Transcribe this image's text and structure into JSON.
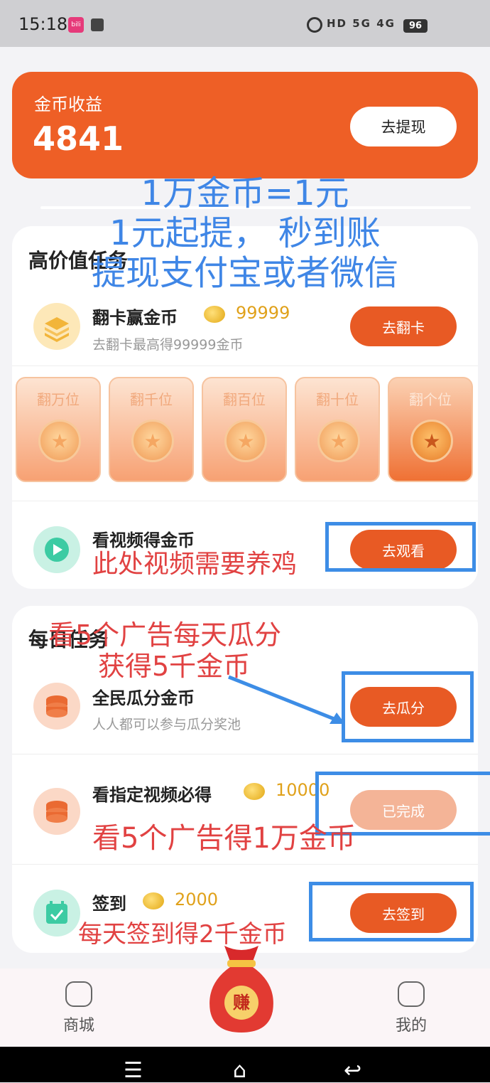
{
  "status": {
    "time": "15:18",
    "app_badge": "bilibili",
    "network": "HD 5G 4G",
    "battery": "96"
  },
  "coin_card": {
    "title": "金币收益",
    "value": "4841",
    "withdraw_label": "去提现"
  },
  "overlay_blue": {
    "line1": "1万金币=1元",
    "line2": "1元起提， 秒到账",
    "line3": "提现支付宝或者微信"
  },
  "high_value": {
    "title": "高价值任务",
    "flip_task": {
      "title": "翻卡赢金币",
      "reward": "99999",
      "sub": "去翻卡最高得99999金币",
      "button": "去翻卡"
    },
    "cards": [
      "翻万位",
      "翻千位",
      "翻百位",
      "翻十位",
      "翻个位"
    ],
    "video_task": {
      "title": "看视频得金币",
      "button": "去观看"
    },
    "video_note": "此处视频需要养鸡"
  },
  "daily": {
    "title": "每日任务",
    "note1": "看5个广告每天瓜分",
    "note2": "获得5千金币",
    "share_task": {
      "title": "全民瓜分金币",
      "sub": "人人都可以参与瓜分奖池",
      "button": "去瓜分"
    },
    "ad_task": {
      "title": "看指定视频必得",
      "reward": "10000",
      "button": "已完成"
    },
    "ad_note": "看5个广告得1万金币",
    "signin_task": {
      "title": "签到",
      "reward": "2000",
      "button": "去签到"
    },
    "signin_note": "每天签到得2千金币"
  },
  "tabs": {
    "left": "商城",
    "center": "赚",
    "right": "我的"
  },
  "colors": {
    "accent": "#e85a24",
    "annotation_blue": "#3d8de6",
    "annotation_red": "#e14242"
  }
}
